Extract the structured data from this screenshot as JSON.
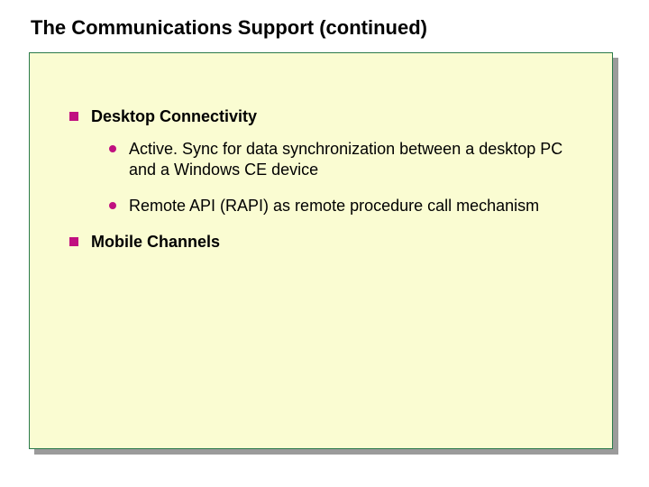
{
  "title": "The Communications Support (continued)",
  "sections": [
    {
      "heading": "Desktop Connectivity",
      "items": [
        "Active. Sync for data synchronization between a desktop PC and a Windows CE device",
        "Remote API (RAPI) as remote procedure call mechanism"
      ]
    },
    {
      "heading": "Mobile Channels",
      "items": []
    }
  ],
  "colors": {
    "panel_bg": "#fafcd2",
    "panel_border": "#2a7a4a",
    "bullet": "#c01080",
    "shadow": "#9b9b9b"
  }
}
